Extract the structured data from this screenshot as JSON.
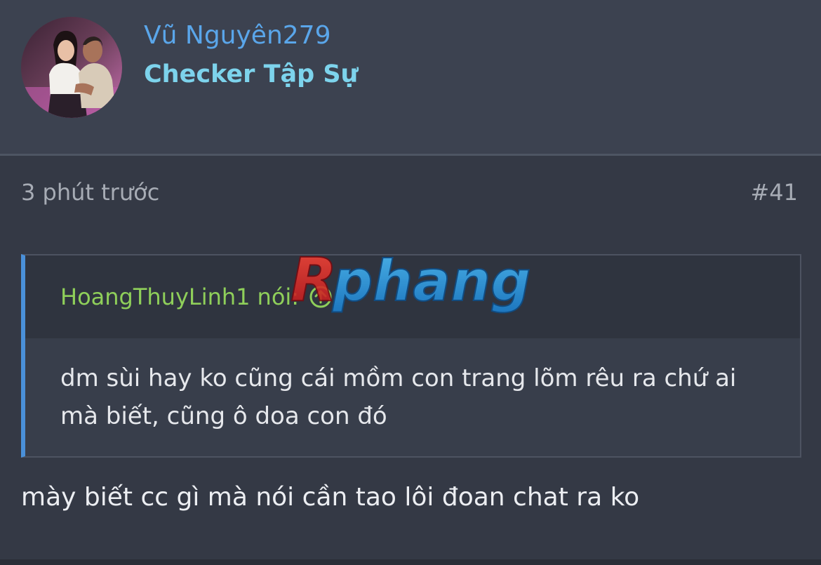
{
  "user": {
    "name": "Vũ Nguyên279",
    "title": "Checker Tập Sự"
  },
  "post": {
    "time": "3 phút trước",
    "number": "#41",
    "reply": "mày biết cc gì mà nói cần tao lôi đoan chat ra ko"
  },
  "quote": {
    "author": "HoangThuyLinh1",
    "said_label": "nói:",
    "text": "dm sùi hay ko cũng cái mồm con trang lõm rêu ra chứ ai mà biết, cũng ô doa con đó"
  },
  "watermark": {
    "text": "Rphang"
  },
  "colors": {
    "username": "#5aa6ea",
    "user_title": "#7dd3ec",
    "quote_author": "#8fcf5a",
    "quote_accent": "#4a90d9"
  },
  "icons": {
    "jump": "arrow-up-circle-icon"
  }
}
